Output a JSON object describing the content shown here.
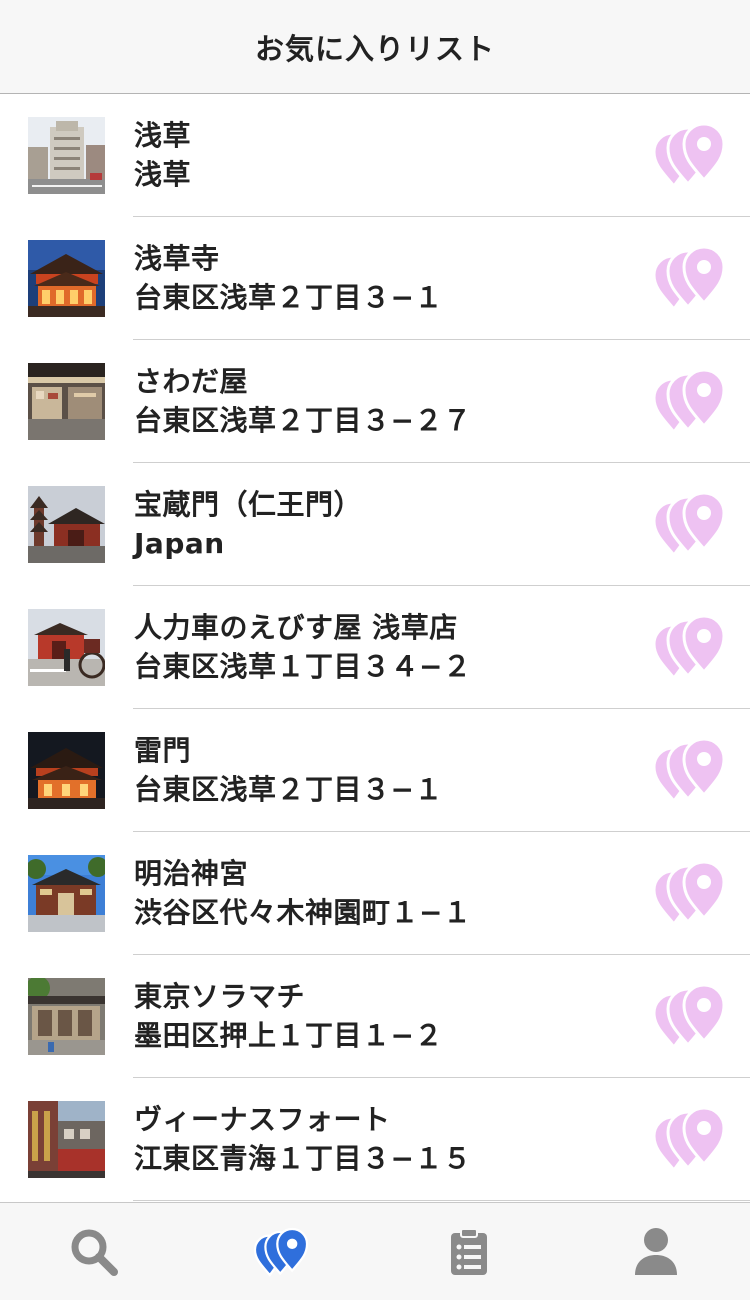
{
  "header": {
    "title": "お気に入りリスト"
  },
  "colors": {
    "favorite_pin": "#eec2f2",
    "tab_active": "#2f6fdc",
    "tab_inactive": "#8a8a8a"
  },
  "favorites": [
    {
      "title": "浅草",
      "subtitle": "浅草",
      "thumbnail": "street-building-photo"
    },
    {
      "title": "浅草寺",
      "subtitle": "台東区浅草２丁目３−１",
      "thumbnail": "temple-night-photo"
    },
    {
      "title": "さわだ屋",
      "subtitle": "台東区浅草２丁目３−２７",
      "thumbnail": "shop-arcade-photo"
    },
    {
      "title": "宝蔵門（仁王門）",
      "subtitle": "Japan",
      "thumbnail": "pagoda-gate-photo"
    },
    {
      "title": "人力車のえびす屋 浅草店",
      "subtitle": "台東区浅草１丁目３４−２",
      "thumbnail": "rickshaw-photo"
    },
    {
      "title": "雷門",
      "subtitle": "台東区浅草２丁目３−１",
      "thumbnail": "temple-night-photo"
    },
    {
      "title": "明治神宮",
      "subtitle": "渋谷区代々木神園町１−１",
      "thumbnail": "shrine-gate-photo"
    },
    {
      "title": "東京ソラマチ",
      "subtitle": "墨田区押上１丁目１−２",
      "thumbnail": "storefront-photo"
    },
    {
      "title": "ヴィーナスフォート",
      "subtitle": "江東区青海１丁目３−１５",
      "thumbnail": "mall-facade-photo"
    }
  ],
  "tabs": [
    {
      "icon": "search-icon",
      "active": false
    },
    {
      "icon": "map-pins-icon",
      "active": true
    },
    {
      "icon": "clipboard-list-icon",
      "active": false
    },
    {
      "icon": "user-icon",
      "active": false
    }
  ]
}
